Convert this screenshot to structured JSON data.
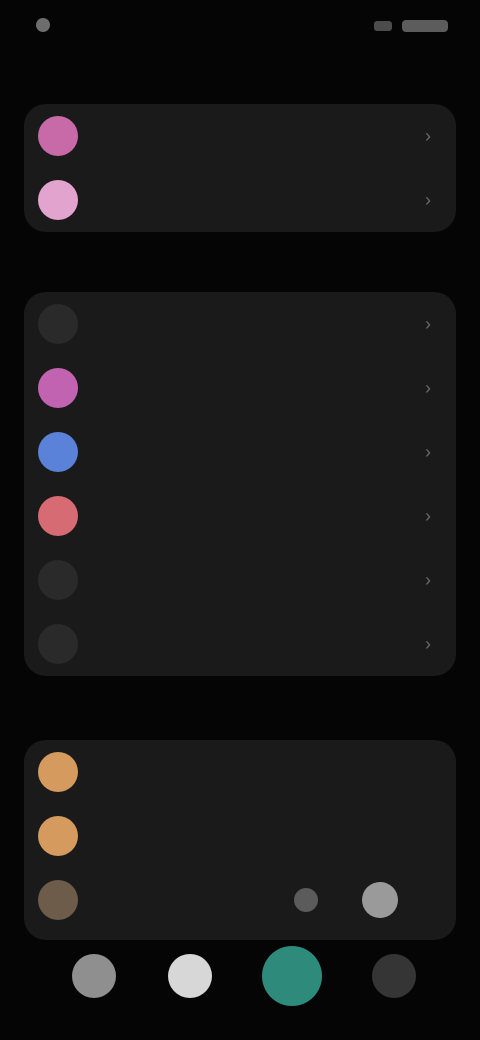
{
  "status": {
    "time": "",
    "battery": ""
  },
  "header": {
    "title": ""
  },
  "top_card": {
    "rows": [
      {
        "label": "",
        "icon": "pink-circle",
        "color": "#c86aa8"
      },
      {
        "label": "",
        "icon": "light-pink-circle",
        "color": "#e2a3cf"
      }
    ]
  },
  "section1_label": "",
  "list_card": {
    "rows": [
      {
        "label": "",
        "icon": "none",
        "color": "#2a2a2a"
      },
      {
        "label": "",
        "icon": "magenta-circle",
        "color": "#c263b2"
      },
      {
        "label": "",
        "icon": "blue-circle",
        "color": "#5a82d8"
      },
      {
        "label": "",
        "icon": "red-circle",
        "color": "#d66b73"
      },
      {
        "label": "",
        "icon": "none",
        "color": "#2a2a2a"
      },
      {
        "label": "",
        "icon": "none",
        "color": "#2a2a2a"
      }
    ]
  },
  "section2_label": "",
  "bottom_card": {
    "rows": [
      {
        "label": "",
        "icon": "orange-circle",
        "color": "#d49a5e"
      },
      {
        "label": "",
        "icon": "orange-circle",
        "color": "#d49a5e"
      },
      {
        "label": "",
        "icon": "gray-circle",
        "color": "#6d5c4a"
      }
    ],
    "toggle_text": ""
  },
  "dock": [
    {
      "icon": "gray-icon",
      "color": "#8f8f8f"
    },
    {
      "icon": "white-icon",
      "color": "#d7d7d7"
    },
    {
      "icon": "teal-icon",
      "color": "#2e8a7b"
    },
    {
      "icon": "dark-icon",
      "color": "#353535"
    }
  ]
}
